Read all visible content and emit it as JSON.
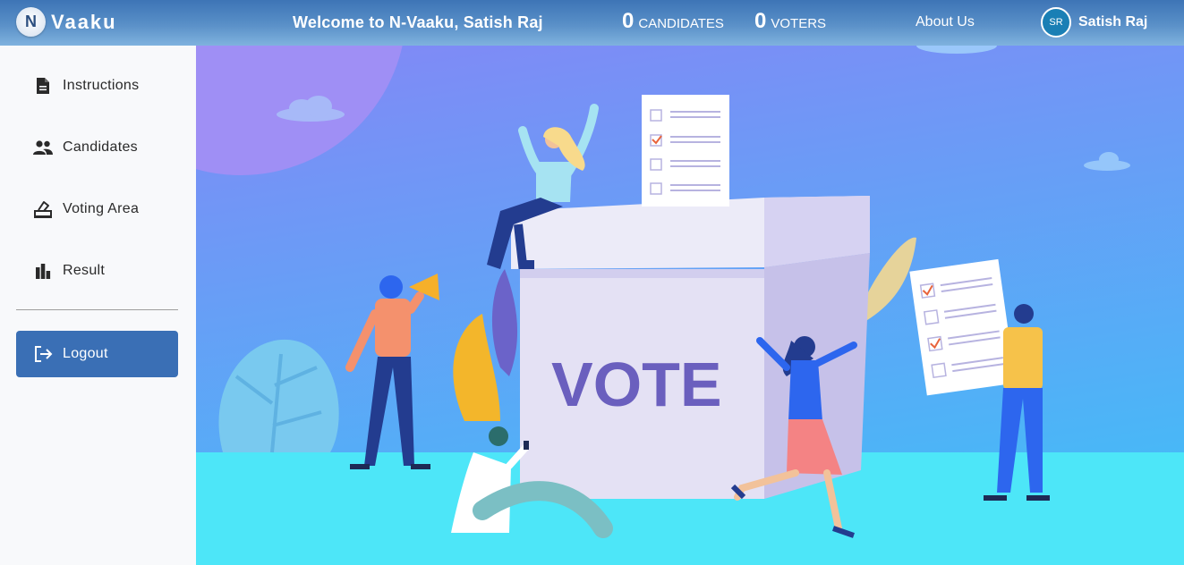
{
  "header": {
    "logo_letter": "N",
    "logo_text": "Vaaku",
    "welcome": "Welcome to N-Vaaku, Satish Raj",
    "candidates_count": "0",
    "candidates_label": "CANDIDATES",
    "voters_count": "0",
    "voters_label": "VOTERS",
    "about": "About Us",
    "user_initials": "SR",
    "user_name": "Satish Raj"
  },
  "sidebar": {
    "items": [
      {
        "label": "Instructions",
        "icon": "document-icon"
      },
      {
        "label": "Candidates",
        "icon": "people-icon"
      },
      {
        "label": "Voting Area",
        "icon": "ballot-icon"
      },
      {
        "label": "Result",
        "icon": "bar-chart-icon"
      }
    ],
    "logout": {
      "label": "Logout",
      "icon": "logout-icon"
    }
  },
  "hero": {
    "box_text": "VOTE",
    "colors": {
      "sky_top": "#8288f6",
      "sky_bottom": "#48b8f7",
      "ground": "#4de6f8",
      "box_front": "#e4e1f4",
      "box_side": "#c6c1e9",
      "vote_text": "#6a5fbe"
    }
  }
}
